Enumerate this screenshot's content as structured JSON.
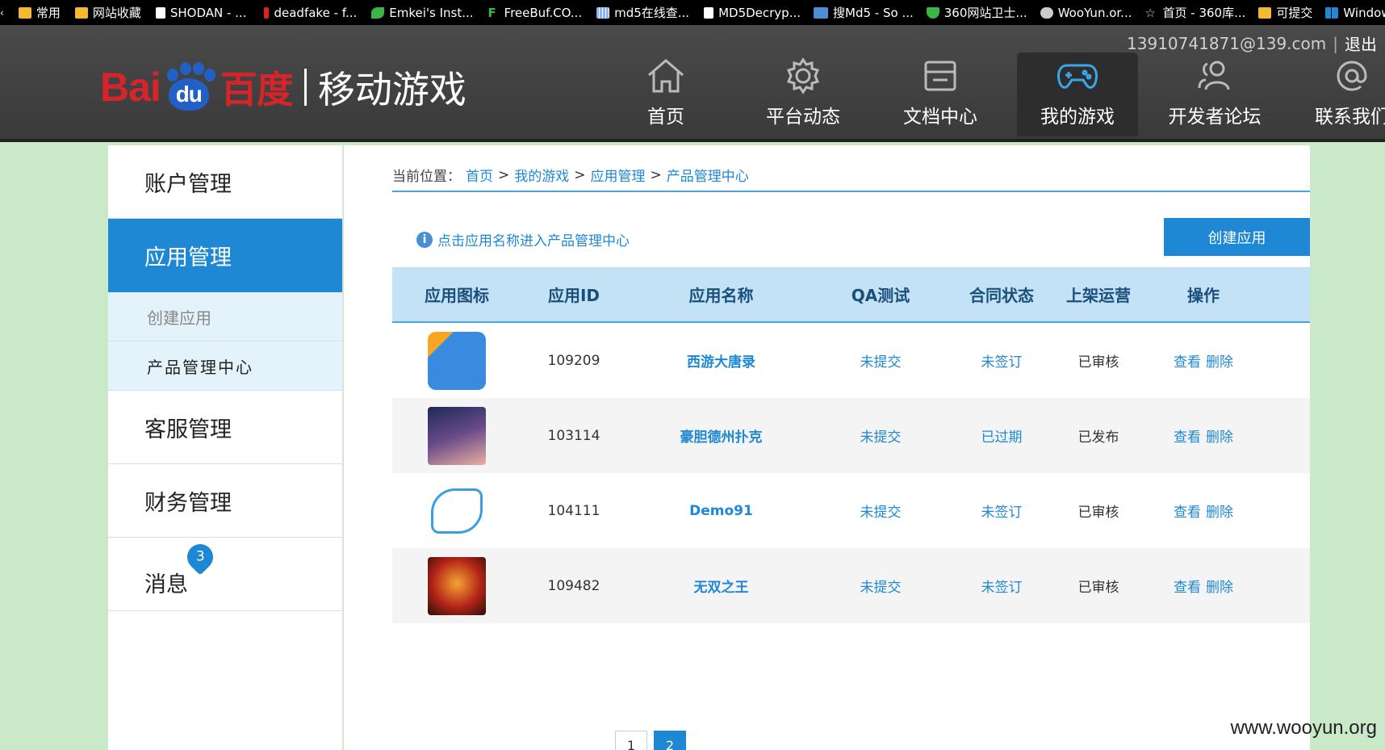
{
  "bookmarks": [
    {
      "label": "常用",
      "icon": "folder-icon",
      "color": "#f5b82e"
    },
    {
      "label": "网站收藏",
      "icon": "folder-icon",
      "color": "#f5b82e"
    },
    {
      "label": "SHODAN - ...",
      "icon": "page-icon",
      "color": "#ffffff"
    },
    {
      "label": "deadfake - f...",
      "icon": "red-bar-icon",
      "color": "#e02020"
    },
    {
      "label": "Emkei's Inst...",
      "icon": "leaf-icon",
      "color": "#3ab54a"
    },
    {
      "label": "FreeBuf.CO...",
      "icon": "f-icon",
      "color": "#3ab54a"
    },
    {
      "label": "md5在线查...",
      "icon": "grid-icon",
      "color": "#8ab4f8"
    },
    {
      "label": "MD5Decryp...",
      "icon": "page-icon",
      "color": "#ffffff"
    },
    {
      "label": "搜Md5 - So ...",
      "icon": "md5-icon",
      "color": "#4a8fd1"
    },
    {
      "label": "360网站卫士...",
      "icon": "shield-icon",
      "color": "#3ab54a"
    },
    {
      "label": "WooYun.or...",
      "icon": "cloud-icon",
      "color": "#cccccc"
    },
    {
      "label": "首页 - 360库...",
      "icon": "star-icon",
      "color": "#cccccc"
    },
    {
      "label": "可提交",
      "icon": "folder-icon",
      "color": "#f5b82e"
    },
    {
      "label": "Windows",
      "icon": "windows-icon",
      "color": "#1e88d5"
    }
  ],
  "header": {
    "account_email": "13910741871@139.com",
    "separator": "|",
    "logout": "退出",
    "logo_baidu_text": "Bai",
    "logo_du": "du",
    "logo_cn": "百度",
    "logo_title": "移动游戏",
    "nav": [
      {
        "label": "首页",
        "icon": "home-icon"
      },
      {
        "label": "平台动态",
        "icon": "gear-icon"
      },
      {
        "label": "文档中心",
        "icon": "document-icon"
      },
      {
        "label": "我的游戏",
        "icon": "gamepad-icon",
        "active": true
      },
      {
        "label": "开发者论坛",
        "icon": "users-icon"
      },
      {
        "label": "联系我们",
        "icon": "at-icon"
      }
    ]
  },
  "sidebar": {
    "account": "账户管理",
    "app_mgmt": "应用管理",
    "sub_create": "创建应用",
    "sub_product": "产品管理中心",
    "service": "客服管理",
    "finance": "财务管理",
    "messages": "消息",
    "messages_badge": "3"
  },
  "main": {
    "breadcrumb": {
      "prefix": "当前位置：",
      "items": [
        "首页",
        "我的游戏",
        "应用管理",
        "产品管理中心"
      ],
      "sep": ">"
    },
    "hint": "点击应用名称进入产品管理中心",
    "create_button": "创建应用",
    "table": {
      "headers": [
        "应用图标",
        "应用ID",
        "应用名称",
        "QA测试",
        "合同状态",
        "上架运营",
        "操作"
      ],
      "rows": [
        {
          "id": "109209",
          "name": "西游大唐录",
          "qa": "未提交",
          "contract": "未签订",
          "listing": "已审核",
          "view": "查看",
          "delete": "删除",
          "icon": "dev-app-icon"
        },
        {
          "id": "103114",
          "name": "豪胆德州扑克",
          "qa": "未提交",
          "contract": "已过期",
          "listing": "已发布",
          "view": "查看",
          "delete": "删除",
          "icon": "poker-app-icon"
        },
        {
          "id": "104111",
          "name": "Demo91",
          "qa": "未提交",
          "contract": "未签订",
          "listing": "已审核",
          "view": "查看",
          "delete": "删除",
          "icon": "zhangju-app-icon"
        },
        {
          "id": "109482",
          "name": "无双之王",
          "qa": "未提交",
          "contract": "未签订",
          "listing": "已审核",
          "view": "查看",
          "delete": "删除",
          "icon": "warrior-app-icon"
        }
      ]
    },
    "pager": [
      "1",
      "2"
    ],
    "current_page": "2"
  },
  "watermark": "www.wooyun.org",
  "colors": {
    "accent": "#1e88d5",
    "header_bg": "#404040",
    "page_bg": "#c9e9c8"
  }
}
